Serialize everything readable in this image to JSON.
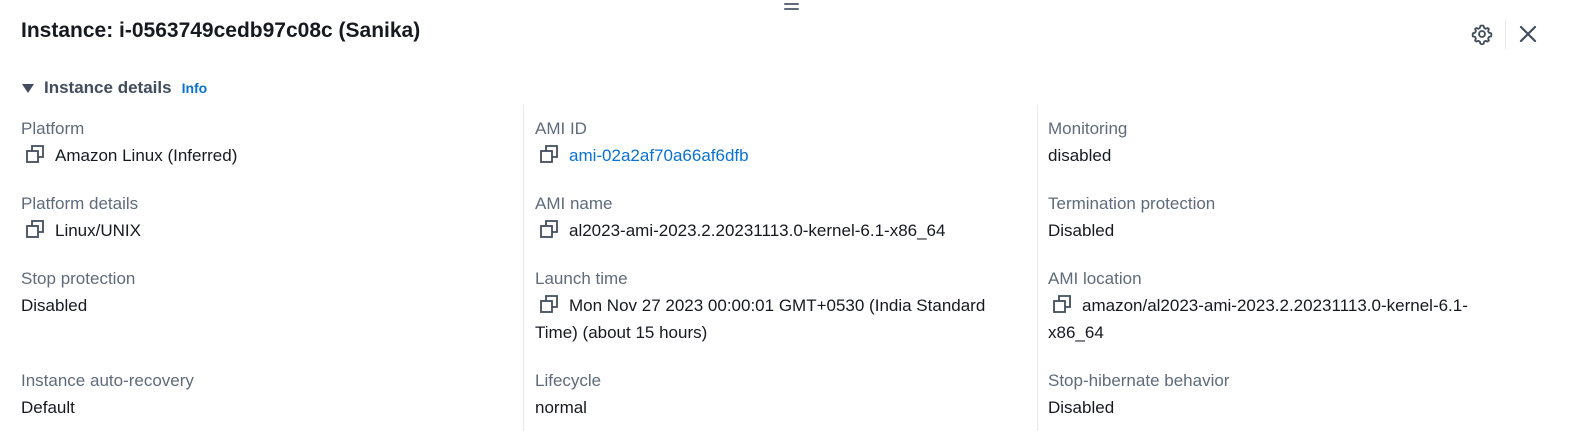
{
  "header": {
    "title": "Instance: i-0563749cedb97c08c (Sanika)",
    "settings_icon": "gear-icon",
    "close_icon": "close-icon"
  },
  "section": {
    "title": "Instance details",
    "info_label": "Info",
    "expanded": true
  },
  "columns": [
    [
      {
        "label": "Platform",
        "value": "Amazon Linux (Inferred)",
        "copyable": true
      },
      {
        "label": "Platform details",
        "value": "Linux/UNIX",
        "copyable": true
      },
      {
        "label": "Stop protection",
        "value": "Disabled",
        "copyable": false
      },
      {
        "label": "Instance auto-recovery",
        "value": "Default",
        "copyable": false
      }
    ],
    [
      {
        "label": "AMI ID",
        "value": "ami-02a2af70a66af6dfb",
        "copyable": true,
        "link": true
      },
      {
        "label": "AMI name",
        "value": "al2023-ami-2023.2.20231113.0-kernel-6.1-x86_64",
        "copyable": true
      },
      {
        "label": "Launch time",
        "value": "Mon Nov 27 2023 00:00:01 GMT+0530 (India Standard Time) (about 15 hours)",
        "copyable": true
      },
      {
        "label": "Lifecycle",
        "value": "normal",
        "copyable": false
      }
    ],
    [
      {
        "label": "Monitoring",
        "value": "disabled",
        "copyable": false
      },
      {
        "label": "Termination protection",
        "value": "Disabled",
        "copyable": false
      },
      {
        "label": "AMI location",
        "value": "amazon/al2023-ami-2023.2.20231113.0-kernel-6.1-x86_64",
        "copyable": true
      },
      {
        "label": "Stop-hibernate behavior",
        "value": "Disabled",
        "copyable": false
      }
    ]
  ],
  "colors": {
    "link": "#0972d3",
    "label": "#5f6b7a",
    "text": "#16191f"
  }
}
